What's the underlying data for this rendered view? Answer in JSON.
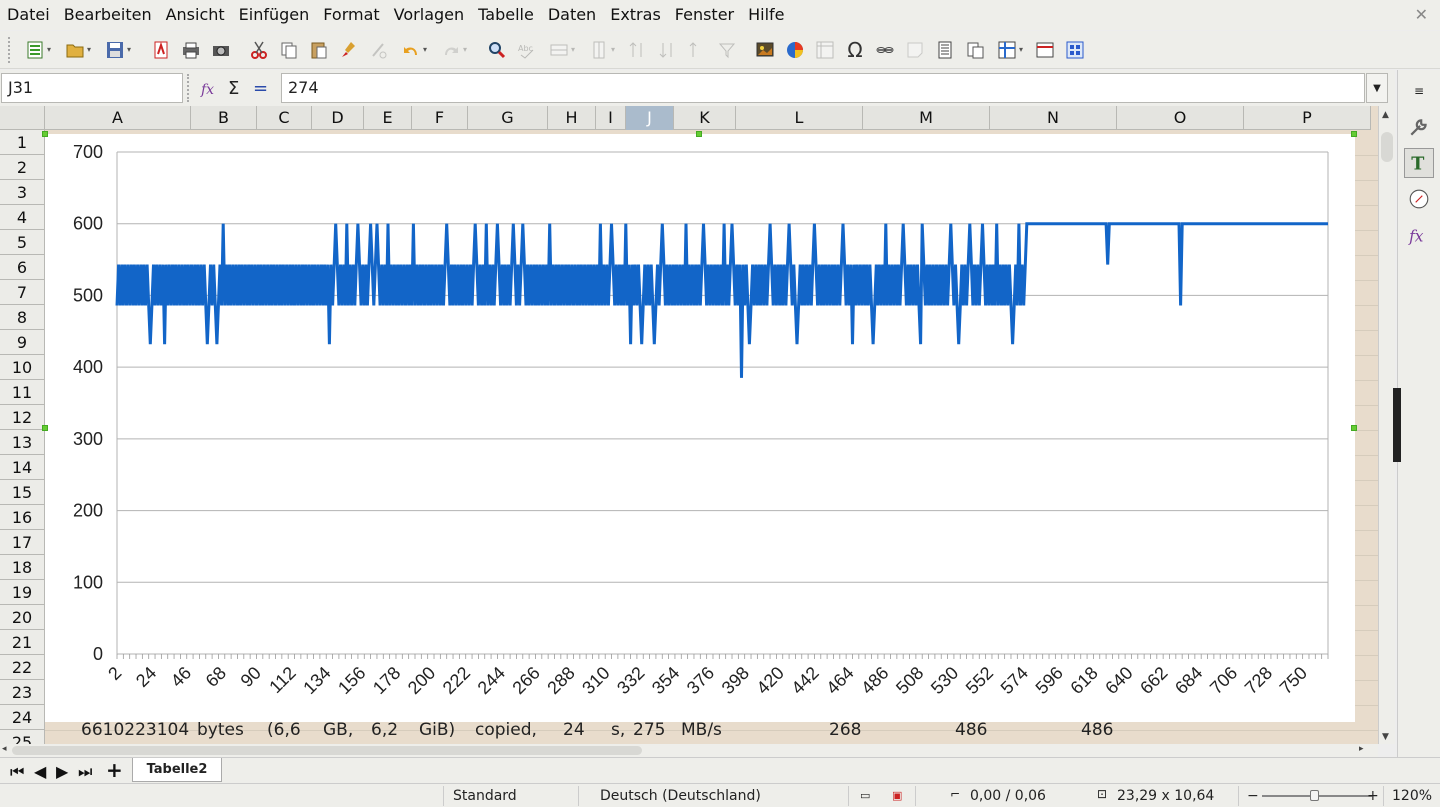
{
  "menu": [
    "Datei",
    "Bearbeiten",
    "Ansicht",
    "Einfügen",
    "Format",
    "Vorlagen",
    "Tabelle",
    "Daten",
    "Extras",
    "Fenster",
    "Hilfe"
  ],
  "formula_bar": {
    "cell_ref": "J31",
    "value": "274",
    "sum_symbol": "Σ",
    "equals_symbol": "="
  },
  "columns": [
    {
      "name": "A",
      "sel": false
    },
    {
      "name": "B",
      "sel": false
    },
    {
      "name": "C",
      "sel": false
    },
    {
      "name": "D",
      "sel": false
    },
    {
      "name": "E",
      "sel": false
    },
    {
      "name": "F",
      "sel": false
    },
    {
      "name": "G",
      "sel": false
    },
    {
      "name": "H",
      "sel": false
    },
    {
      "name": "I",
      "sel": false
    },
    {
      "name": "J",
      "sel": true
    },
    {
      "name": "K",
      "sel": false
    },
    {
      "name": "L",
      "sel": false
    },
    {
      "name": "M",
      "sel": false
    },
    {
      "name": "N",
      "sel": false
    },
    {
      "name": "O",
      "sel": false
    },
    {
      "name": "P",
      "sel": false
    }
  ],
  "rows": [
    "1",
    "2",
    "3",
    "4",
    "5",
    "6",
    "7",
    "8",
    "9",
    "10",
    "11",
    "12",
    "13",
    "14",
    "15",
    "16",
    "17",
    "18",
    "19",
    "20",
    "21",
    "22",
    "23",
    "24",
    "25"
  ],
  "row25": {
    "A": "6610223104",
    "B": "bytes",
    "C": "(6,6",
    "D": "GB,",
    "E": "6,2",
    "F": "GiB)",
    "G": "copied,",
    "H": "24",
    "I": "s,",
    "J": "275",
    "K": "MB/s",
    "L": "268",
    "M": "486",
    "N": "486"
  },
  "sheet_tab": "Tabelle2",
  "status": {
    "page_style": "Standard",
    "language": "Deutsch (Deutschland)",
    "position": "0,00 / 0,06",
    "size": "23,29 x 10,64",
    "zoom": "120%",
    "zoom_minus": "−",
    "zoom_plus": "+"
  },
  "chart_data": {
    "type": "line",
    "title": "",
    "xlabel": "",
    "ylabel": "",
    "ylim": [
      0,
      700
    ],
    "yticks": [
      "0",
      "100",
      "200",
      "300",
      "400",
      "500",
      "600",
      "700"
    ],
    "xlim": [
      1,
      765
    ],
    "xticks": [
      "2",
      "24",
      "46",
      "68",
      "90",
      "112",
      "134",
      "156",
      "178",
      "200",
      "222",
      "244",
      "266",
      "288",
      "310",
      "332",
      "354",
      "376",
      "398",
      "420",
      "442",
      "464",
      "486",
      "508",
      "530",
      "552",
      "574",
      "596",
      "618",
      "640",
      "662",
      "684",
      "706",
      "728",
      "750"
    ],
    "grid": "horizontal",
    "series": [
      {
        "color": "#1265c8",
        "segments": [
          {
            "x": [
              1,
              575
            ],
            "y_low": 486,
            "y_high": 543,
            "note_values": [
              486,
              543,
              600
            ]
          },
          {
            "x": [
              575,
              765
            ],
            "y": 600
          }
        ],
        "dips": [
          {
            "x": 22,
            "y": 432
          },
          {
            "x": 31,
            "y": 432
          },
          {
            "x": 58,
            "y": 432
          },
          {
            "x": 64,
            "y": 432
          },
          {
            "x": 135,
            "y": 432
          },
          {
            "x": 325,
            "y": 432
          },
          {
            "x": 332,
            "y": 432
          },
          {
            "x": 340,
            "y": 432
          },
          {
            "x": 395,
            "y": 385
          },
          {
            "x": 400,
            "y": 432
          },
          {
            "x": 430,
            "y": 432
          },
          {
            "x": 465,
            "y": 432
          },
          {
            "x": 478,
            "y": 432
          },
          {
            "x": 508,
            "y": 432
          },
          {
            "x": 532,
            "y": 432
          },
          {
            "x": 566,
            "y": 432
          },
          {
            "x": 626,
            "y": 543
          },
          {
            "x": 672,
            "y": 486
          }
        ],
        "peaks": [
          68,
          139,
          146,
          153,
          161,
          165,
          172,
          188,
          209,
          227,
          234,
          241,
          251,
          257,
          274,
          306,
          313,
          322,
          345,
          360,
          371,
          384,
          389,
          413,
          425,
          441,
          459,
          486,
          497,
          509,
          527,
          539,
          547,
          556,
          570
        ]
      }
    ]
  }
}
